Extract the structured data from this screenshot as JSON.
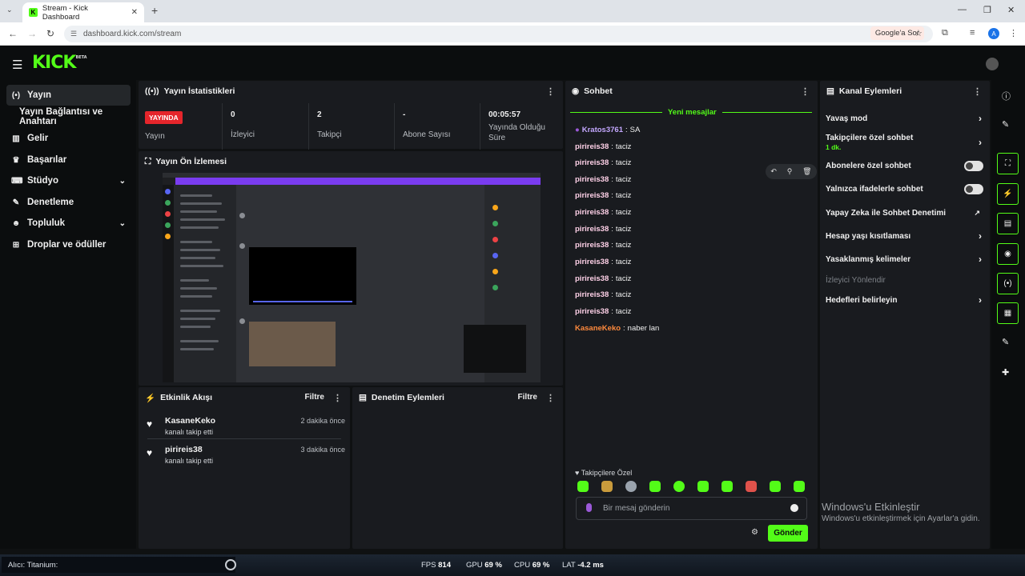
{
  "browser": {
    "tab_title": "Stream - Kick Dashboard",
    "url": "dashboard.kick.com/stream",
    "google_chip": "Google'a Sor",
    "profile_initial": "A"
  },
  "app": {
    "logo": "KICK",
    "logo_badge": "BETA"
  },
  "nav": {
    "items": [
      {
        "label": "Yayın",
        "icon": "broadcast-icon"
      },
      {
        "label": "Yayın Bağlantısı ve Anahtarı"
      },
      {
        "label": "Gelir",
        "icon": "chart-icon"
      },
      {
        "label": "Başarılar",
        "icon": "trophy-icon"
      },
      {
        "label": "Stüdyo",
        "icon": "keyboard-icon"
      },
      {
        "label": "Denetleme",
        "icon": "wrench-icon"
      },
      {
        "label": "Topluluk",
        "icon": "people-icon"
      },
      {
        "label": "Droplar ve ödüller",
        "icon": "tree-icon"
      }
    ]
  },
  "stats": {
    "title": "Yayın İstatistikleri",
    "live_badge": "YAYINDA",
    "live_label": "Yayın",
    "viewers_value": "0",
    "viewers_label": "İzleyici",
    "followers_value": "2",
    "followers_label": "Takipçi",
    "subs_value": "-",
    "subs_label": "Abone Sayısı",
    "uptime_value": "00:05:57",
    "uptime_label": "Yayında Olduğu Süre"
  },
  "preview": {
    "title": "Yayın Ön İzlemesi"
  },
  "activity": {
    "title": "Etkinlik Akışı",
    "filter": "Filtre",
    "events": [
      {
        "user": "KasaneKeko",
        "action": "kanalı takip etti",
        "time": "2 dakika önce"
      },
      {
        "user": "pirireis38",
        "action": "kanalı takip etti",
        "time": "3 dakika önce"
      }
    ]
  },
  "moderation": {
    "title": "Denetim Eylemleri",
    "filter": "Filtre"
  },
  "chat": {
    "title": "Sohbet",
    "new_messages": "Yeni mesajlar",
    "messages": [
      {
        "user": "Kratos3761",
        "text": "SA",
        "color": "#c4a8ff"
      },
      {
        "user": "pirireis38",
        "text": "taciz",
        "color": "#ffd1e8"
      },
      {
        "user": "pirireis38",
        "text": "taciz",
        "color": "#ffd1e8"
      },
      {
        "user": "pirireis38",
        "text": "taciz",
        "color": "#ffd1e8"
      },
      {
        "user": "pirireis38",
        "text": "taciz",
        "color": "#ffd1e8"
      },
      {
        "user": "pirireis38",
        "text": "taciz",
        "color": "#ffd1e8"
      },
      {
        "user": "pirireis38",
        "text": "taciz",
        "color": "#ffd1e8"
      },
      {
        "user": "pirireis38",
        "text": "taciz",
        "color": "#ffd1e8"
      },
      {
        "user": "pirireis38",
        "text": "taciz",
        "color": "#ffd1e8"
      },
      {
        "user": "pirireis38",
        "text": "taciz",
        "color": "#ffd1e8"
      },
      {
        "user": "pirireis38",
        "text": "taciz",
        "color": "#ffd1e8"
      },
      {
        "user": "pirireis38",
        "text": "taciz",
        "color": "#ffd1e8"
      },
      {
        "user": "KasaneKeko",
        "text": "naber lan",
        "color": "#ff8a3d"
      }
    ],
    "followers_only": "Takipçilere Özel",
    "input_placeholder": "Bir mesaj gönderin",
    "send": "Gönder"
  },
  "channel_actions": {
    "title": "Kanal Eylemleri",
    "slow_mode": "Yavaş mod",
    "followers_chat": "Takipçilere özel sohbet",
    "followers_chat_value": "1 dk.",
    "subs_chat": "Abonelere özel sohbet",
    "emote_chat": "Yalnızca ifadelerle sohbet",
    "ai_mod": "Yapay Zeka ile Sohbet Denetimi",
    "age_limit": "Hesap yaşı kısıtlaması",
    "banned_words": "Yasaklanmış kelimeler",
    "redirect": "İzleyici Yönlendir",
    "goals": "Hedefleri belirleyin"
  },
  "windows": {
    "line1": "Windows'u Etkinleştir",
    "line2": "Windows'u etkinleştirmek için Ayarlar'a gidin."
  },
  "osd": {
    "device": "Alıcı: Titanium:",
    "fps_label": "FPS",
    "fps": "814",
    "gpu_label": "GPU",
    "gpu": "69 %",
    "cpu_label": "CPU",
    "cpu": "69 %",
    "lat_label": "LAT",
    "lat": "-4.2 ms"
  },
  "colors": {
    "accent": "#53fc18",
    "live": "#e5252b",
    "panel": "#191b1f"
  }
}
